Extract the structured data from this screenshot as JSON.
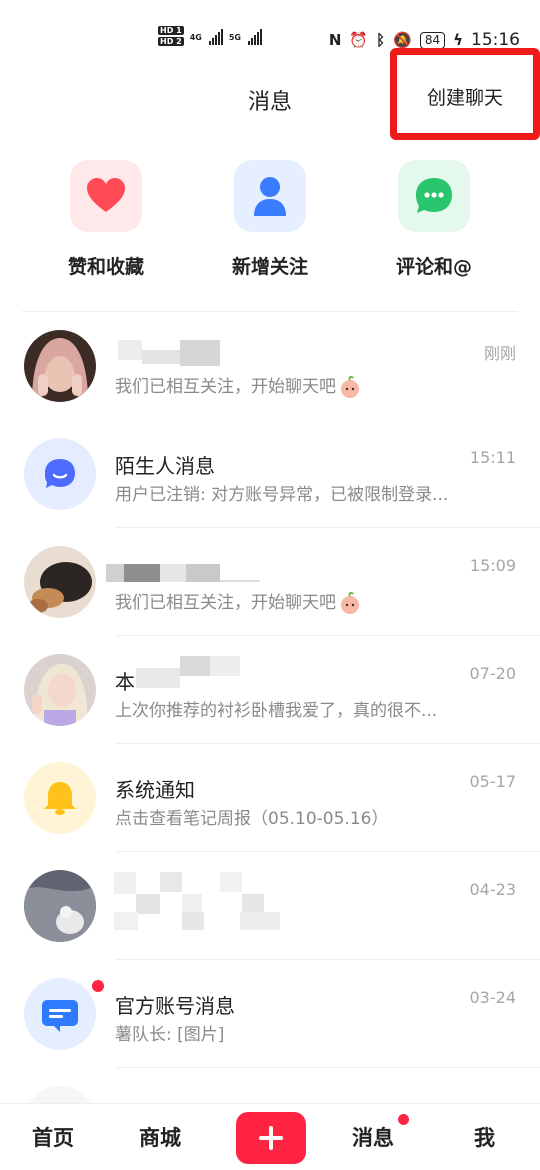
{
  "status_bar": {
    "hd1": "HD 1",
    "hd2": "HD 2",
    "net1": "4G",
    "net2": "5G",
    "battery": "84",
    "time": "15:16"
  },
  "header": {
    "title": "消息",
    "create_chat": "创建聊天"
  },
  "quick_actions": [
    {
      "label": "赞和收藏",
      "icon": "heart-icon",
      "color": "#ff4b55"
    },
    {
      "label": "新增关注",
      "icon": "person-icon",
      "color": "#3a7cff"
    },
    {
      "label": "评论和@",
      "icon": "comment-icon",
      "color": "#29c66d"
    }
  ],
  "conversations": [
    {
      "name": "",
      "preview": "我们已相互关注，开始聊天吧",
      "time": "刚刚"
    },
    {
      "name": "陌生人消息",
      "preview": "用户已注销: 对方账号异常，已被限制登录...",
      "time": "15:11"
    },
    {
      "name": "",
      "preview": "我们已相互关注，开始聊天吧",
      "time": "15:09"
    },
    {
      "name": "本",
      "preview": "上次你推荐的衬衫卧槽我爱了，真的很不...",
      "time": "07-20"
    },
    {
      "name": "系统通知",
      "preview": "点击查看笔记周报（05.10-05.16）",
      "time": "05-17"
    },
    {
      "name": "",
      "preview": "",
      "time": "04-23"
    },
    {
      "name": "官方账号消息",
      "preview": "薯队长: [图片]",
      "time": "03-24"
    }
  ],
  "tabbar": {
    "home": "首页",
    "mall": "商城",
    "messages": "消息",
    "me": "我"
  },
  "colors": {
    "accent": "#ff2442",
    "highlight_box": "#ef1b1b"
  }
}
